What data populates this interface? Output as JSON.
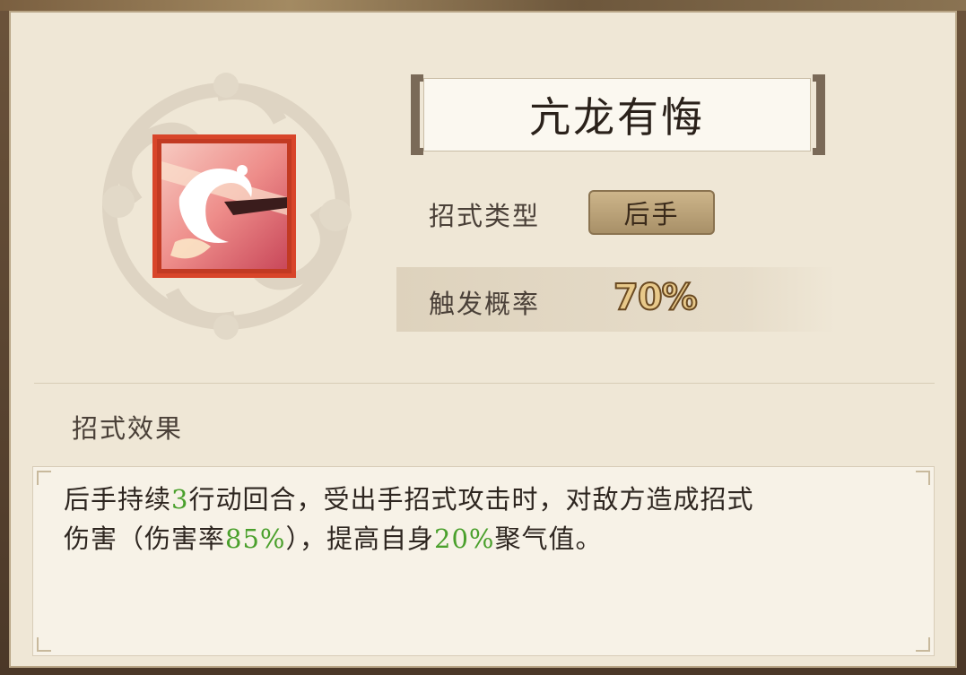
{
  "skill": {
    "name": "亢龙有悔",
    "type_label": "招式类型",
    "type_value": "后手",
    "chance_label": "触发概率",
    "chance_value": "70%",
    "effect_title": "招式效果",
    "effect": {
      "line1_a": "后手持续",
      "line1_num": "3",
      "line1_b": "行动回合，受出手招式攻击时，对敌方造成招式",
      "line2_a": "伤害（伤害率",
      "line2_rate": "85%",
      "line2_b": "），提高自身",
      "line2_pct": "20%",
      "line2_c": "聚气值。"
    }
  },
  "icons": {
    "skill": "white-dragon-icon",
    "emblem": "cloud-emblem-icon"
  },
  "colors": {
    "highlight": "#4aa02c",
    "icon_border": "#d8452a",
    "chance_value": "#e8c98a"
  }
}
